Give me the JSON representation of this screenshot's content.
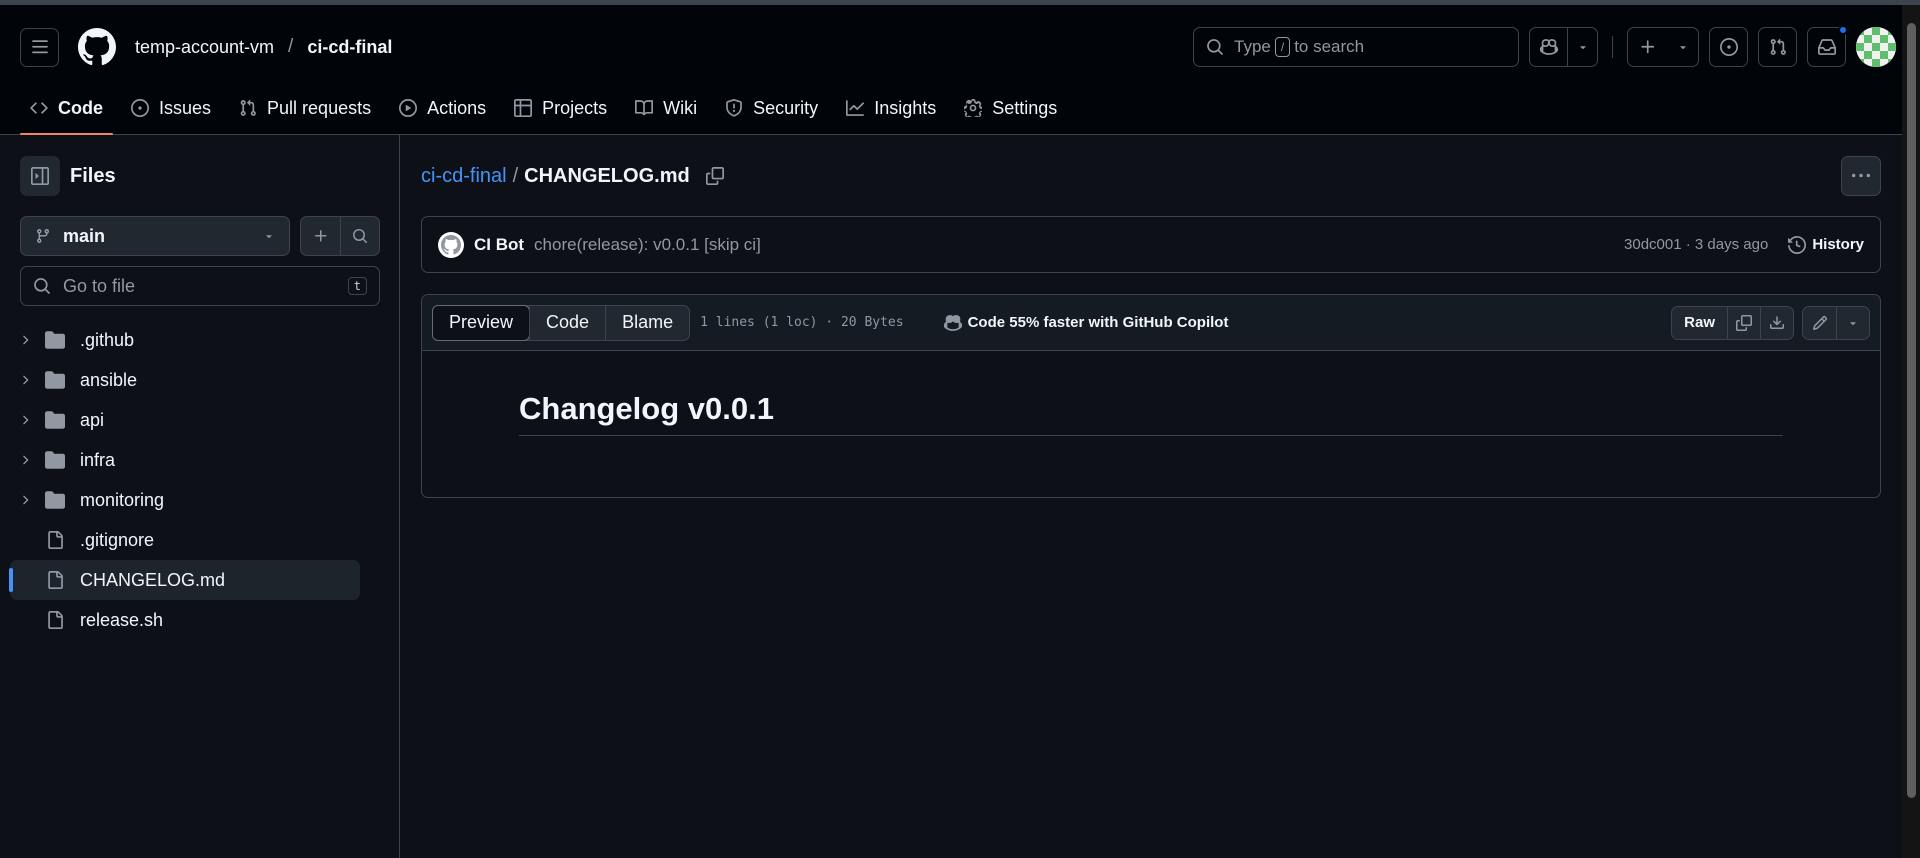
{
  "header": {
    "owner": "temp-account-vm",
    "separator": "/",
    "repo": "ci-cd-final",
    "search": {
      "prefix": "Type",
      "key": "/",
      "suffix": "to search"
    }
  },
  "nav": {
    "tabs": [
      {
        "label": "Code",
        "icon": "code-icon",
        "active": true
      },
      {
        "label": "Issues",
        "icon": "issue-opened-icon"
      },
      {
        "label": "Pull requests",
        "icon": "git-pull-request-icon"
      },
      {
        "label": "Actions",
        "icon": "play-icon"
      },
      {
        "label": "Projects",
        "icon": "table-icon"
      },
      {
        "label": "Wiki",
        "icon": "book-icon"
      },
      {
        "label": "Security",
        "icon": "shield-icon"
      },
      {
        "label": "Insights",
        "icon": "graph-icon"
      },
      {
        "label": "Settings",
        "icon": "gear-icon"
      }
    ]
  },
  "sidebar": {
    "title": "Files",
    "branch": "main",
    "goto_placeholder": "Go to file",
    "goto_shortcut": "t",
    "tree": [
      {
        "name": ".github",
        "type": "dir"
      },
      {
        "name": "ansible",
        "type": "dir"
      },
      {
        "name": "api",
        "type": "dir"
      },
      {
        "name": "infra",
        "type": "dir"
      },
      {
        "name": "monitoring",
        "type": "dir"
      },
      {
        "name": ".gitignore",
        "type": "file"
      },
      {
        "name": "CHANGELOG.md",
        "type": "file",
        "selected": true
      },
      {
        "name": "release.sh",
        "type": "file"
      }
    ]
  },
  "file": {
    "repo_link": "ci-cd-final",
    "separator": "/",
    "name": "CHANGELOG.md",
    "commit": {
      "author": "CI Bot",
      "message": "chore(release): v0.0.1 [skip ci]",
      "meta": "30dc001 · 3 days ago",
      "history_label": "History"
    },
    "toolbar": {
      "views": [
        "Preview",
        "Code",
        "Blame"
      ],
      "active_view": "Preview",
      "info": "1 lines (1 loc) · 20 Bytes",
      "copilot": "Code 55% faster with GitHub Copilot",
      "raw_label": "Raw"
    },
    "content_heading": "Changelog v0.0.1"
  },
  "colors": {
    "accent": "#4493f8",
    "tab_underline": "#f78166",
    "background": "#0d1117",
    "header_bg": "#010409",
    "border": "#3d444d"
  }
}
